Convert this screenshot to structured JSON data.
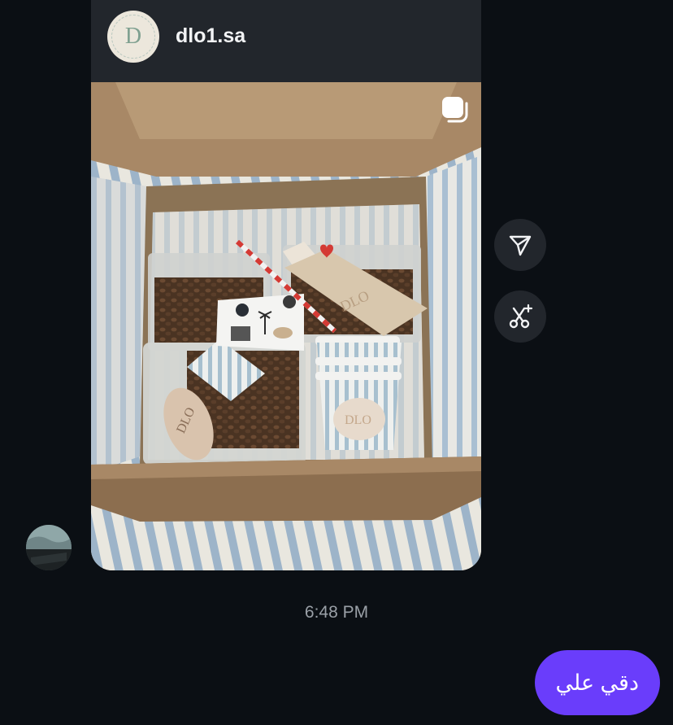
{
  "shared_post": {
    "account_name": "dlo1.sa",
    "avatar_letter": "D",
    "photo_brand_text": "DLO",
    "multi_media_icon": "carousel-icon"
  },
  "actions": {
    "share_icon": "paper-plane-icon",
    "remix_icon": "scissors-sparkle-icon"
  },
  "messages": {
    "timestamp": "6:48 PM",
    "outgoing_text": "دقي علي"
  },
  "colors": {
    "background": "#0b0f14",
    "card": "#22262c",
    "outgoing_bubble": "#6a3dfb",
    "timestamp": "#9aa0a7"
  }
}
